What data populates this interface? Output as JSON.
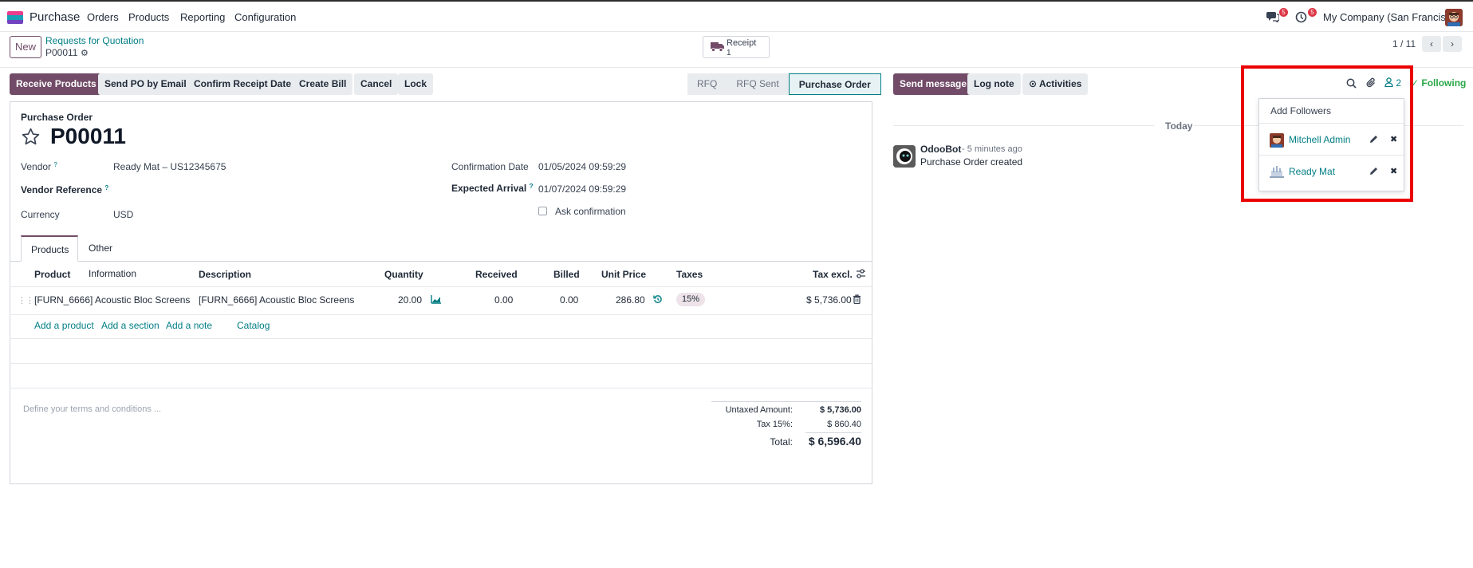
{
  "topbar": {
    "app_name": "Purchase",
    "menu": [
      "Orders",
      "Products",
      "Reporting",
      "Configuration"
    ],
    "messages_badge": "5",
    "activities_badge": "5",
    "company": "My Company (San Francisco)"
  },
  "control_panel": {
    "new_label": "New",
    "breadcrumb_parent": "Requests for Quotation",
    "breadcrumb_current": "P00011",
    "receipt_label": "Receipt",
    "receipt_count": "1",
    "pager": "1 / 11"
  },
  "actions": {
    "receive_products": "Receive Products",
    "send_po": "Send PO by Email",
    "confirm_receipt": "Confirm Receipt Date",
    "create_bill": "Create Bill",
    "cancel": "Cancel",
    "lock": "Lock"
  },
  "statusbar": [
    "RFQ",
    "RFQ Sent",
    "Purchase Order"
  ],
  "form": {
    "doc_type": "Purchase Order",
    "name": "P00011",
    "vendor_label": "Vendor",
    "vendor_value": "Ready Mat – US12345675",
    "vendor_ref_label": "Vendor Reference",
    "currency_label": "Currency",
    "currency_value": "USD",
    "confirmation_date_label": "Confirmation Date",
    "confirmation_date_value": "01/05/2024 09:59:29",
    "expected_arrival_label": "Expected Arrival",
    "expected_arrival_value": "01/07/2024 09:59:29",
    "ask_confirmation_label": "Ask confirmation",
    "help_mark": "?"
  },
  "tabs": [
    "Products",
    "Other Information"
  ],
  "table": {
    "headers": [
      "Product",
      "Description",
      "Quantity",
      "Received",
      "Billed",
      "Unit Price",
      "Taxes",
      "Tax excl."
    ],
    "row": {
      "product": "[FURN_6666] Acoustic Bloc Screens",
      "description": "[FURN_6666] Acoustic Bloc Screens",
      "quantity": "20.00",
      "received": "0.00",
      "billed": "0.00",
      "unit_price": "286.80",
      "tax": "15%",
      "subtotal": "$ 5,736.00"
    },
    "add_links": [
      "Add a product",
      "Add a section",
      "Add a note",
      "Catalog"
    ]
  },
  "terms_placeholder": "Define your terms and conditions ...",
  "totals": {
    "untaxed_label": "Untaxed Amount:",
    "untaxed_value": "$ 5,736.00",
    "tax_label": "Tax 15%:",
    "tax_value": "$ 860.40",
    "total_label": "Total:",
    "total_value": "$ 6,596.40"
  },
  "chatter": {
    "send_message": "Send message",
    "log_note": "Log note",
    "activities": "Activities",
    "followers_count": "2",
    "following": "Following",
    "today": "Today",
    "message_author": "OdooBot",
    "message_time": "- 5 minutes ago",
    "message_body": "Purchase Order created"
  },
  "followers_dropdown": {
    "add_followers": "Add Followers",
    "followers": [
      "Mitchell Admin",
      "Ready Mat"
    ]
  },
  "colors": {
    "brand": "#714b67",
    "link": "#017e84",
    "highlight": "#ea0000",
    "following": "#28a745"
  }
}
